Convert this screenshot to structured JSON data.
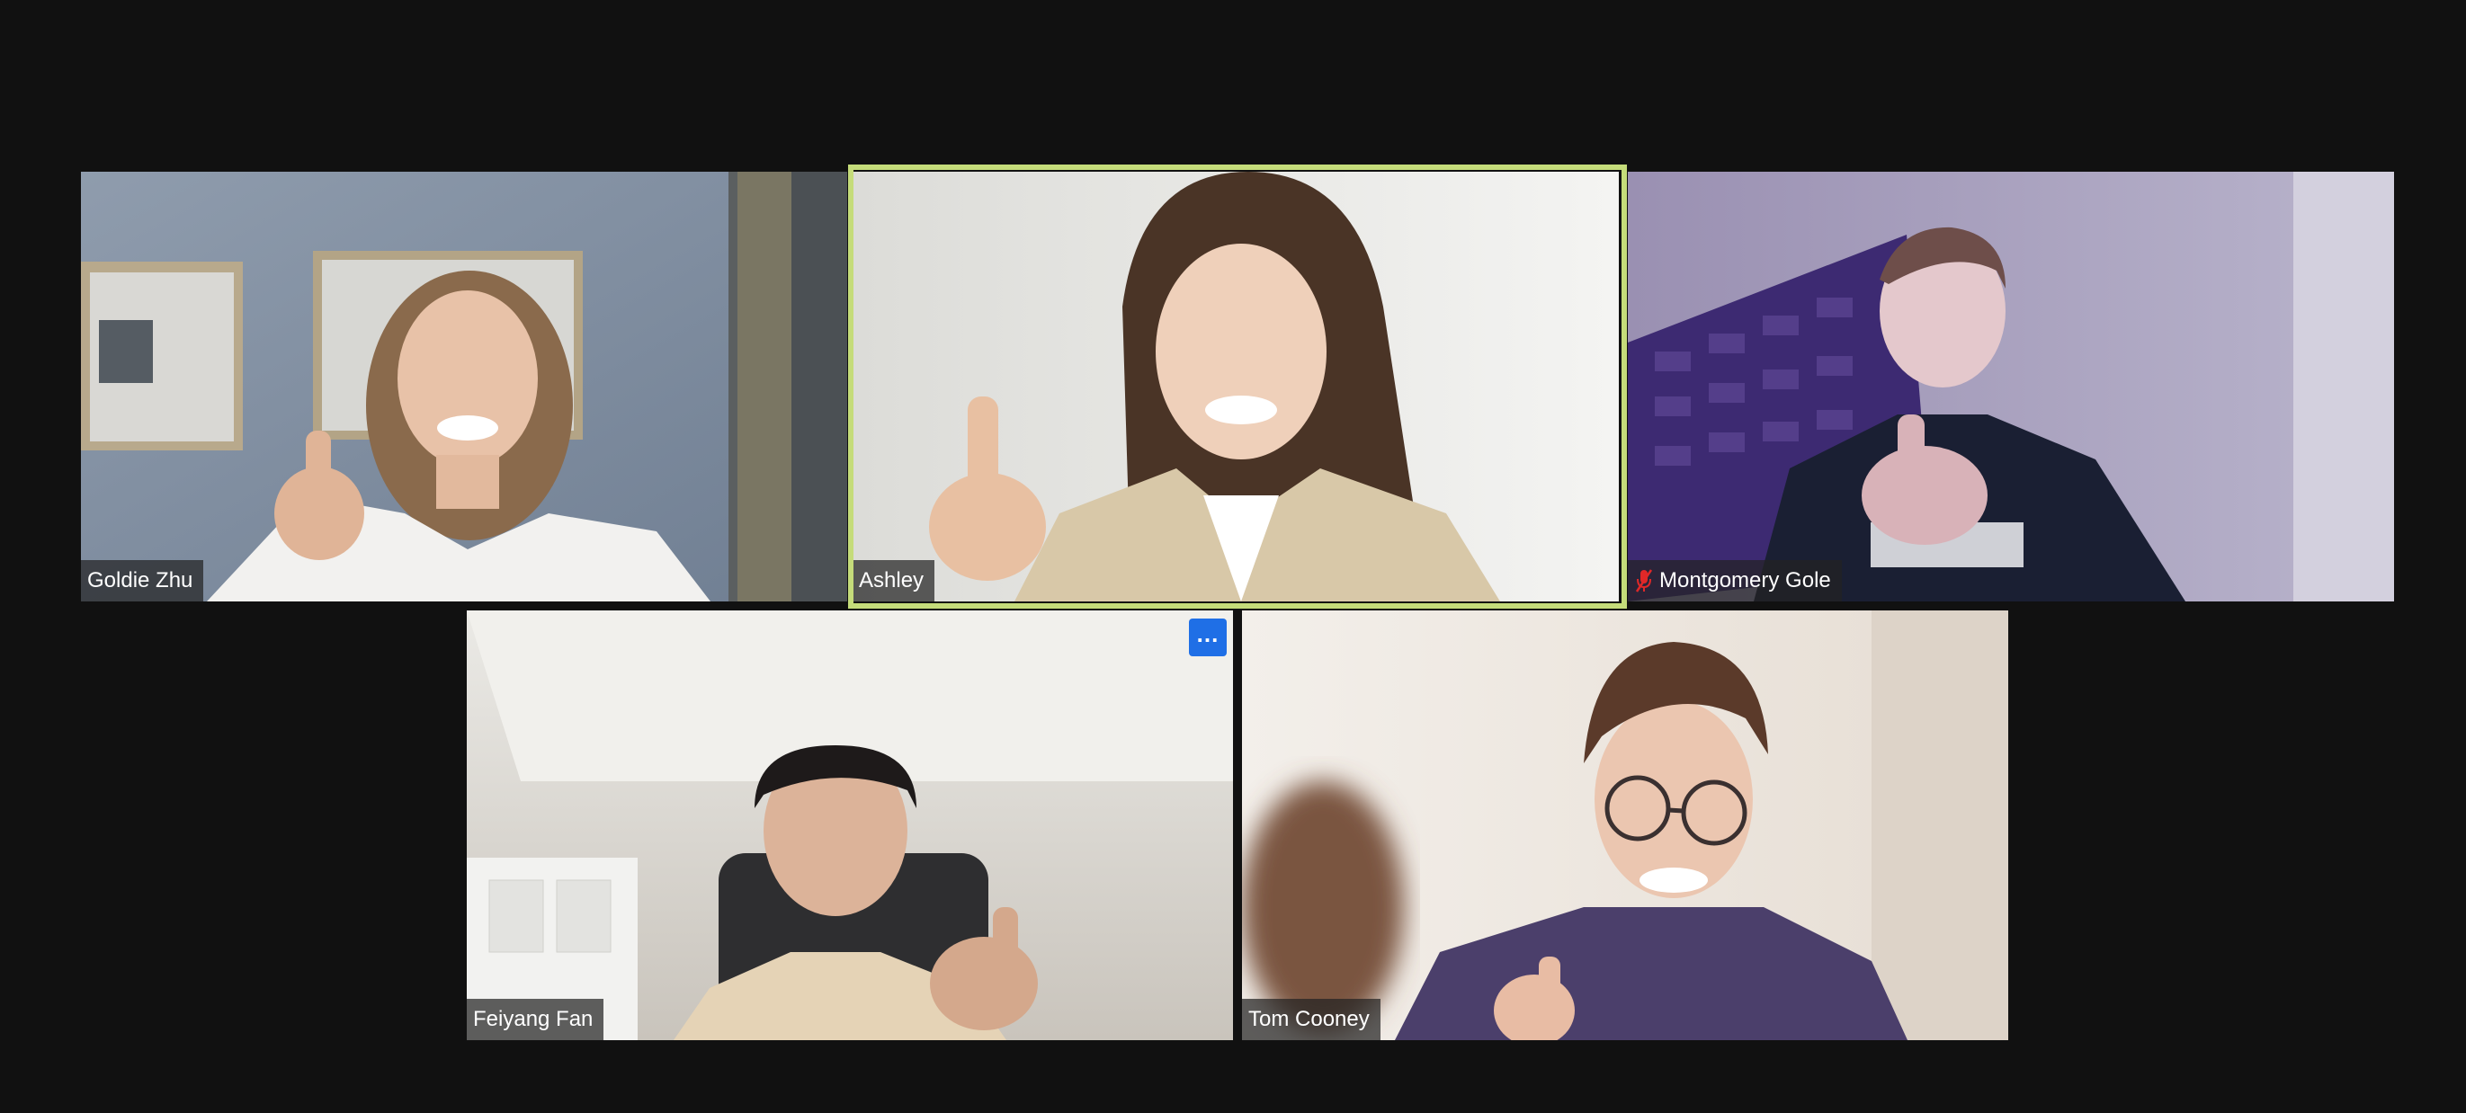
{
  "participants": [
    {
      "name": "Goldie Zhu",
      "muted": false,
      "active_speaker": false
    },
    {
      "name": "Ashley",
      "muted": false,
      "active_speaker": true
    },
    {
      "name": "Montgomery Gole",
      "muted": true,
      "active_speaker": false
    },
    {
      "name": "Feiyang Fan",
      "muted": false,
      "active_speaker": false
    },
    {
      "name": "Tom Cooney",
      "muted": false,
      "active_speaker": false
    }
  ],
  "more_button_label": "...",
  "icons": {
    "muted": "mic-muted-icon",
    "more": "more-options-icon"
  },
  "colors": {
    "background": "#111111",
    "active_speaker_border": "#c5dc7a",
    "more_button": "#1f6fe6",
    "muted_icon": "#e02828"
  }
}
